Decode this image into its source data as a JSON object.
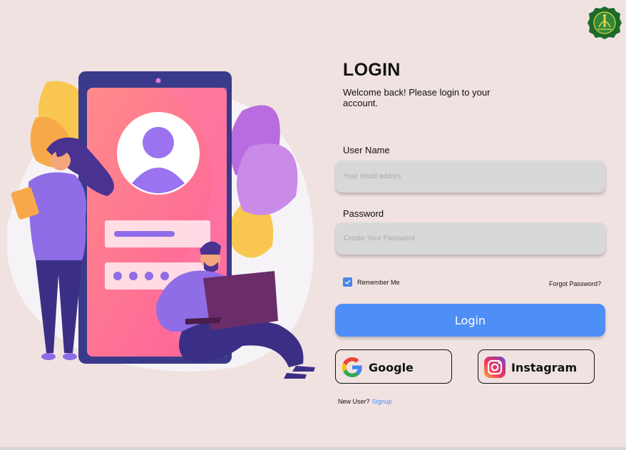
{
  "header": {
    "logo_icon": "university-emblem-icon"
  },
  "login": {
    "title": "LOGIN",
    "subtitle": "Welcome back! Please login to your account."
  },
  "form": {
    "username_label": "User Name",
    "username_placeholder": "Your email addres",
    "password_label": "Password",
    "password_placeholder": "Create Your Password",
    "remember_label": "Remember Me",
    "remember_checked": true,
    "forgot_label": "Forgot Password?",
    "login_label": "Login"
  },
  "social": {
    "google_label": "Google",
    "google_icon": "google-icon",
    "instagram_label": "Instagram",
    "instagram_icon": "instagram-icon"
  },
  "signup": {
    "prompt": "New User?",
    "link_label": "Signup"
  },
  "colors": {
    "background": "#f0e2e1",
    "accent": "#4e8ef7",
    "input_bg": "#d8d8d8"
  }
}
